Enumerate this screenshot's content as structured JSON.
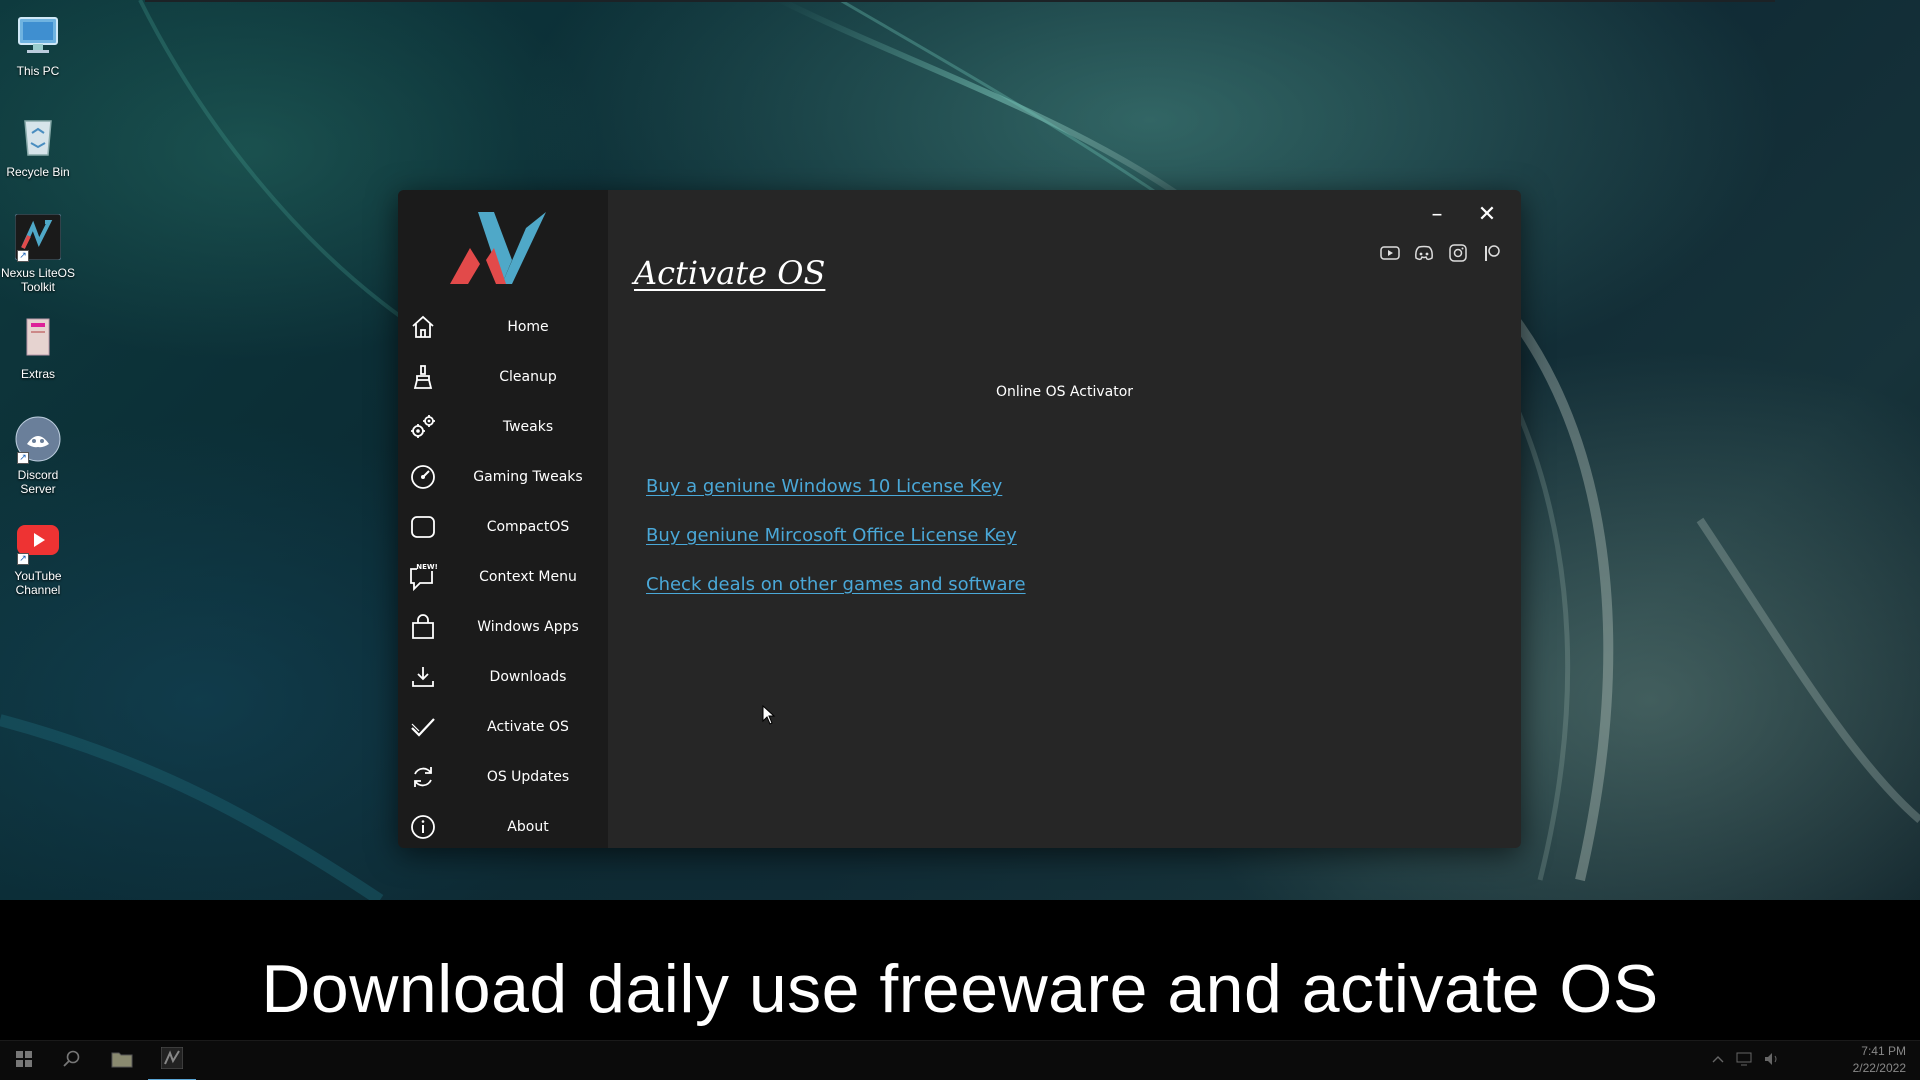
{
  "desktop": {
    "icons": [
      {
        "label": "This PC",
        "icon": "this-pc-icon"
      },
      {
        "label": "Recycle Bin",
        "icon": "recycle-bin-icon"
      },
      {
        "label": "Nexus LiteOS Toolkit",
        "icon": "nexus-app-icon"
      },
      {
        "label": "Extras",
        "icon": "folder-icon"
      },
      {
        "label": "Discord Server",
        "icon": "discord-icon"
      },
      {
        "label": "YouTube Channel",
        "icon": "youtube-icon"
      }
    ]
  },
  "app": {
    "nav": [
      {
        "label": "Home",
        "icon": "home-icon"
      },
      {
        "label": "Cleanup",
        "icon": "broom-icon"
      },
      {
        "label": "Tweaks",
        "icon": "gears-icon"
      },
      {
        "label": "Gaming Tweaks",
        "icon": "speedometer-icon"
      },
      {
        "label": "CompactOS",
        "icon": "square-icon"
      },
      {
        "label": "Context Menu",
        "icon": "context-menu-new-icon",
        "badge": "NEW!"
      },
      {
        "label": "Windows Apps",
        "icon": "shopping-bag-icon"
      },
      {
        "label": "Downloads",
        "icon": "download-icon"
      },
      {
        "label": "Activate OS",
        "icon": "checkmark-icon",
        "active": true
      },
      {
        "label": "OS Updates",
        "icon": "refresh-icon"
      },
      {
        "label": "About",
        "icon": "info-icon"
      }
    ],
    "window_controls": {
      "minimize": "–",
      "close": "✕"
    },
    "social": [
      "youtube-icon",
      "discord-icon",
      "instagram-icon",
      "patreon-icon"
    ],
    "page_title": "Activate OS",
    "section_heading": "Online OS Activator",
    "links": [
      "Buy a geniune Windows 10 License Key",
      "Buy geniune Mircosoft Office License Key",
      "Check deals on other games and software"
    ]
  },
  "caption": "Download daily use freeware and activate OS",
  "taskbar": {
    "clock_time": "7:41 PM",
    "clock_date": "2/22/2022"
  },
  "colors": {
    "sidebar_bg": "#1b1b1b",
    "content_bg": "#262626",
    "link": "#4aa8d8",
    "logo_red": "#e24a4a",
    "logo_teal": "#4fa8c8"
  }
}
